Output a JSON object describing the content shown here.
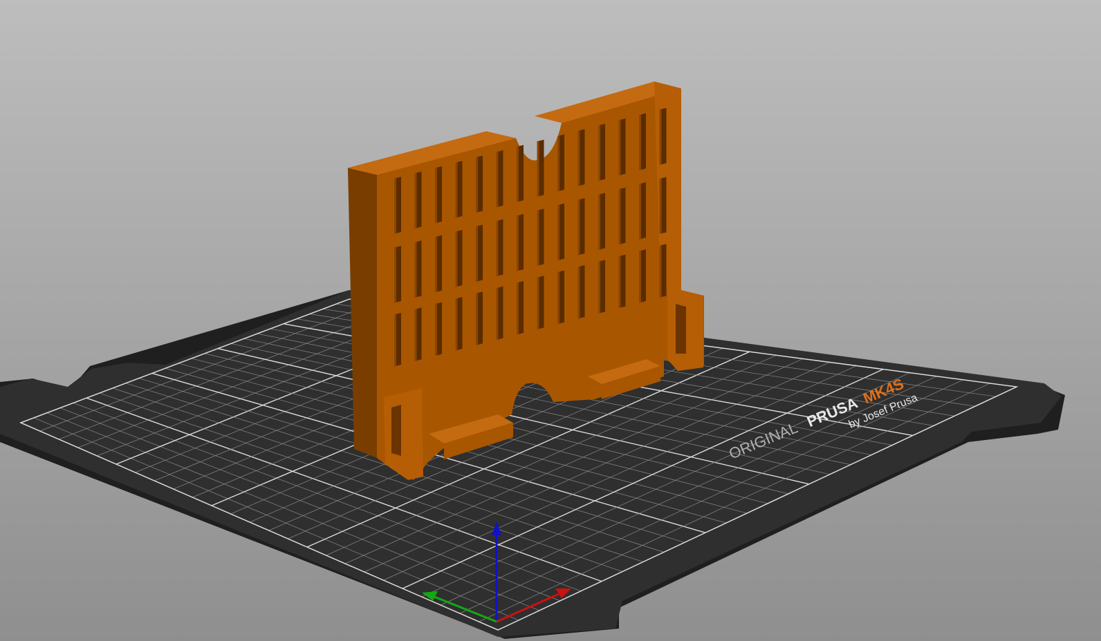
{
  "viewport": {
    "bed_logo": {
      "prefix": "ORIGINAL",
      "brand": "PRUSA",
      "model": "MK4S",
      "byline": "by Josef Prusa"
    },
    "colors": {
      "background_top": "#bdbdbd",
      "background_bottom": "#8f8f8f",
      "bed": "#2f2f2f",
      "bed_edge": "#1f1f1f",
      "grid": "#8a8a8a",
      "grid_major": "#dcdcdc",
      "model_front": "#a95600",
      "model_side": "#7a3d00",
      "model_top": "#c46a10",
      "logo_white": "#e8e8e8",
      "logo_orange": "#e0701a",
      "logo_gray": "#b0b0b0",
      "axis_x": "#cc1111",
      "axis_y": "#11aa11",
      "axis_z": "#1111cc"
    },
    "axes_icon": "xyz-axes-gizmo",
    "model_name": "orange-printed-part"
  }
}
